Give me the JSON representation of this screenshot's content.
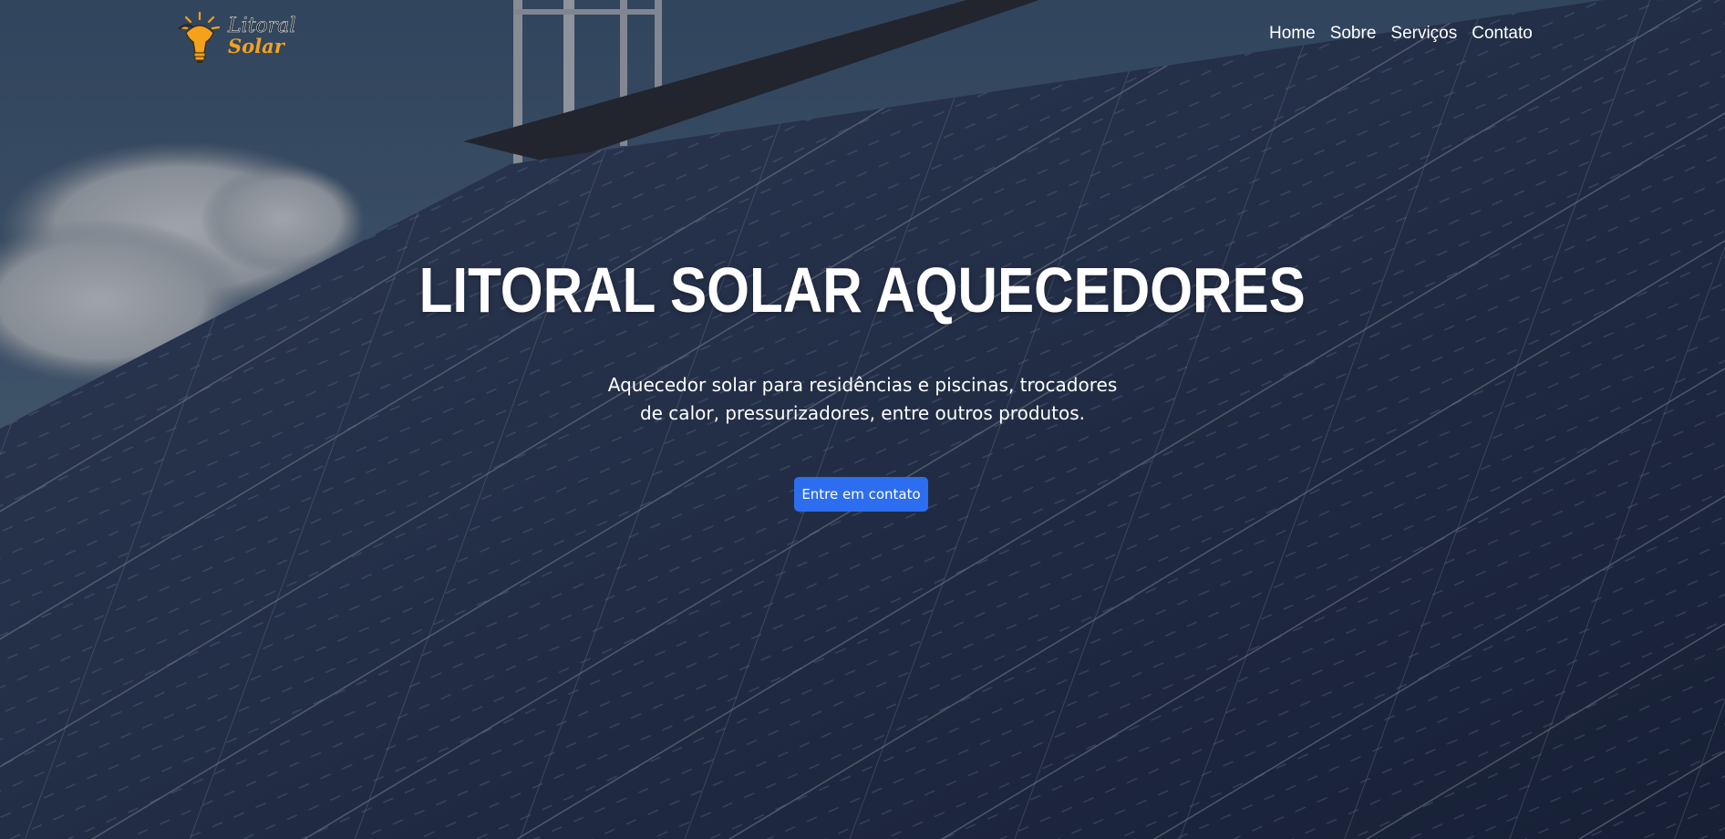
{
  "header": {
    "logo": {
      "name": "litoral-solar-logo",
      "text_top": "Litoral",
      "text_bottom": "Solar",
      "colors": {
        "accent": "#f4a21c",
        "dark": "#1e1e1e"
      }
    },
    "nav": {
      "items": [
        {
          "label": "Home"
        },
        {
          "label": "Sobre"
        },
        {
          "label": "Serviços"
        },
        {
          "label": "Contato"
        }
      ]
    }
  },
  "hero": {
    "background_image": "solar-panels-photo",
    "title": "LITORAL SOLAR AQUECEDORES",
    "subtitle_line1": "Aquecedor solar para residências e piscinas, trocadores",
    "subtitle_line2": "de calor, pressurizadores, entre outros produtos.",
    "cta_label": "Entre em contato",
    "colors": {
      "cta": "#2d6df0",
      "text": "#ffffff"
    }
  }
}
